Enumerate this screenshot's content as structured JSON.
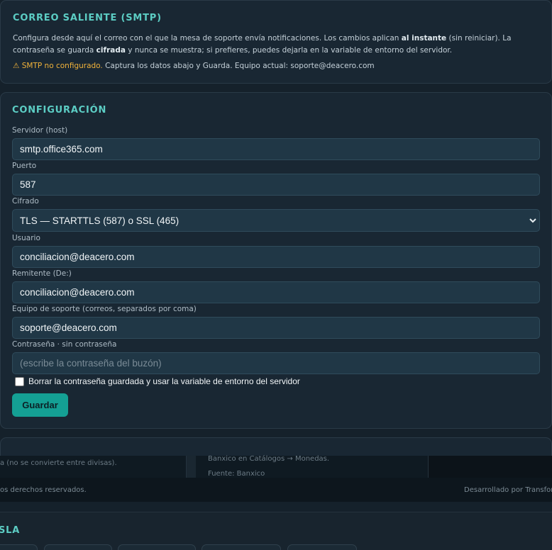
{
  "smtp_section": {
    "title": "CORREO SALIENTE (SMTP)",
    "desc_part1": "Configura desde aquí el correo con el que la mesa de soporte envía notificaciones. Los cambios aplican ",
    "desc_bold1": "al instante",
    "desc_part2": " (sin reiniciar). La contraseña se guarda ",
    "desc_bold2": "cifrada",
    "desc_part3": " y nunca se muestra; si prefieres, puedes dejarla en la variable de entorno del servidor.",
    "warning_flag": "⚠ SMTP no configurado.",
    "warning_text": " Captura los datos abajo y Guarda. Equipo actual: soporte@deacero.com"
  },
  "config": {
    "title": "CONFIGURACIÓN",
    "host_label": "Servidor (host)",
    "host_value": "smtp.office365.com",
    "port_label": "Puerto",
    "port_value": "587",
    "cipher_label": "Cifrado",
    "cipher_selected": "TLS — STARTTLS (587) o SSL (465)",
    "user_label": "Usuario",
    "user_value": "conciliacion@deacero.com",
    "from_label": "Remitente (De:)",
    "from_value": "conciliacion@deacero.com",
    "team_label": "Equipo de soporte (correos, separados por coma)",
    "team_value": "soporte@deacero.com",
    "password_label": "Contraseña · sin contraseña",
    "password_placeholder": "(escribe la contraseña del buzón)",
    "clear_password_label": "Borrar la contraseña guardada y usar la variable de entorno del servidor",
    "save_label": "Guardar"
  },
  "background": {
    "col1_text": "a (no se convierte entre divisas).",
    "col2_text1": "Banxico en Catálogos → Monedas.",
    "col2_text2": "Fuente: Banxico",
    "footer_left": "os derechos reservados.",
    "footer_right": "Desarrollado por Transfor",
    "section_title": "SLA"
  },
  "colors": {
    "accent": "#5ccdc4",
    "button": "#14a094",
    "warning": "#f0b23a",
    "input_bg": "#203746"
  }
}
